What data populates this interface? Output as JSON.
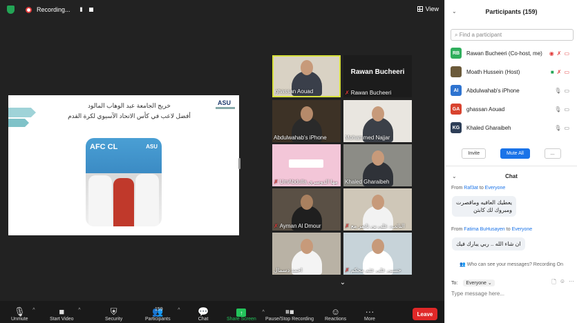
{
  "topbar": {
    "recording_label": "Recording...",
    "pause_glyph": "II",
    "view_label": "View"
  },
  "slide": {
    "line1": "خريج الجامعة عبد الوهاب المالود",
    "line2": "أفضل لاعب في كأس الاتحاد الآسيوي لكرة القدم",
    "logo": "ASU",
    "photo_text_left": "AFC\nCL",
    "photo_text_right": "ASU"
  },
  "gallery": [
    {
      "name": "ghassan Aouad",
      "muted": false,
      "active": true
    },
    {
      "name": "Rawan Bucheeri",
      "muted": true,
      "active": false,
      "display_name": "Rawan Bucheeri"
    },
    {
      "name": "Abdulwahab's iPhone",
      "muted": false
    },
    {
      "name": "Mohammed Najjar",
      "muted": false
    },
    {
      "name": "UmAbdulla مها الدوسري",
      "muted": true
    },
    {
      "name": "Khaled Gharaibeh",
      "muted": false
    },
    {
      "name": "Ayman Al Dmour",
      "muted": true
    },
    {
      "name": "النائب، علي بن ناصر مع",
      "muted": true
    },
    {
      "name": "احمد دسمال",
      "muted": false
    },
    {
      "name": "حسين علي عثم محكم",
      "muted": true
    }
  ],
  "toolbar": {
    "unmute": "Unmute",
    "start_video": "Start Video",
    "security": "Security",
    "participants": "Participants",
    "participants_count": "159",
    "chat": "Chat",
    "share_screen": "Share Screen",
    "recording": "Pause/Stop Recording",
    "reactions": "Reactions",
    "more": "More",
    "leave": "Leave"
  },
  "participants": {
    "title": "Participants (159)",
    "search_placeholder": "Find a participant",
    "list": [
      {
        "initials": "RB",
        "color": "#2fae5c",
        "name": "Rawan Bucheeri (Co-host, me)"
      },
      {
        "initials": "",
        "color": "#6b5a3a",
        "name": "Moath Hussein (Host)"
      },
      {
        "initials": "AI",
        "color": "#2f74d0",
        "name": "Abdulwahab's iPhone"
      },
      {
        "initials": "GA",
        "color": "#d8432f",
        "name": "ghassan Aouad"
      },
      {
        "initials": "KG",
        "color": "#2d3e57",
        "name": "Khaled Gharaibeh"
      }
    ],
    "invite": "Invite",
    "mute_all": "Mute All",
    "more": "..."
  },
  "chat": {
    "title": "Chat",
    "messages": [
      {
        "from": "Raf3at",
        "to": "Everyone",
        "text_line1": "يعطيك العافيه وماقصرت",
        "text_line2": "ومبروك لك كابتن"
      },
      {
        "from": "Fatima BuHusayen",
        "to": "Everyone",
        "text_line1": "ان شاء الله .. ربي يبارك فيك",
        "text_line2": ""
      }
    ],
    "from_word": "From",
    "to_word": "to",
    "who_can_see": "Who can see your messages? Recording On",
    "to_label": "To:",
    "to_value": "Everyone",
    "input_placeholder": "Type message here..."
  },
  "colors": {
    "accent": "#1a73e8",
    "leave": "#e02828",
    "share": "#23c35a",
    "active_speaker": "#d8e13b"
  }
}
